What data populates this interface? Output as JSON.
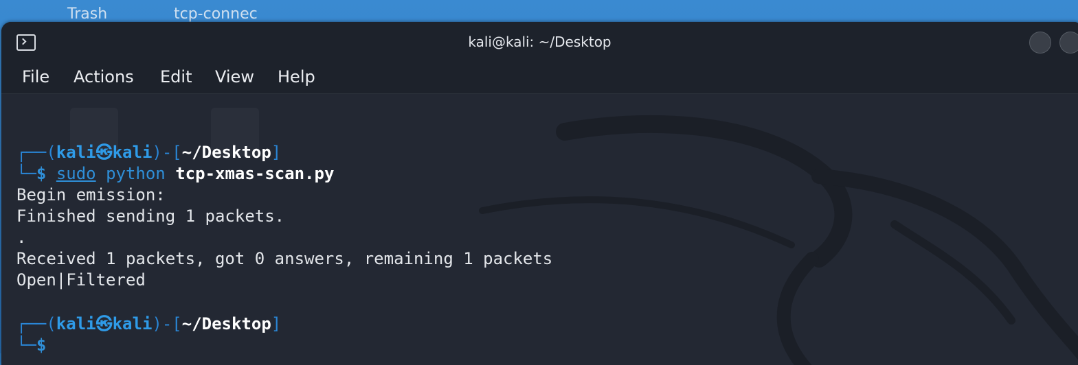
{
  "desktop": {
    "icons": [
      {
        "label": "Trash"
      },
      {
        "label": "tcp-connec"
      }
    ]
  },
  "window": {
    "title": "kali@kali: ~/Desktop",
    "menu": [
      "File",
      "Actions",
      "Edit",
      "View",
      "Help"
    ]
  },
  "terminal": {
    "prompt1": {
      "frame_top": "┌──(",
      "user": "kali",
      "at": "㉿",
      "host": "kali",
      "mid": ")-[",
      "path": "~/Desktop",
      "end": "]",
      "frame_bottom": "└─",
      "dollar": "$",
      "cmd_sudo": "sudo",
      "cmd_python": "python",
      "cmd_arg": "tcp-xmas-scan.py"
    },
    "output": [
      "Begin emission:",
      "Finished sending 1 packets.",
      ".",
      "Received 1 packets, got 0 answers, remaining 1 packets",
      "Open|Filtered"
    ],
    "prompt2": {
      "frame_top": "┌──(",
      "user": "kali",
      "at": "㉿",
      "host": "kali",
      "mid": ")-[",
      "path": "~/Desktop",
      "end": "]",
      "frame_bottom": "└─",
      "dollar": "$"
    }
  },
  "colors": {
    "terminal_bg": "#232833",
    "prompt_blue": "#2f8fd8",
    "titlebar_bg": "#1d222b"
  }
}
